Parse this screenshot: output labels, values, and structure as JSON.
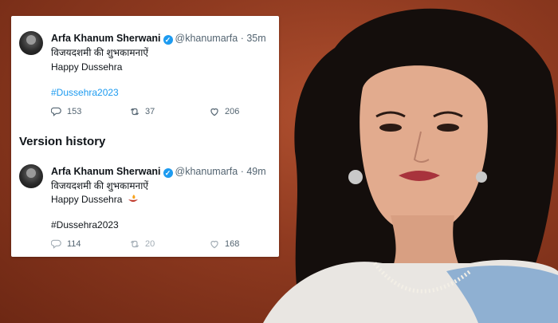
{
  "colors": {
    "accent": "#1d9bf0",
    "background": "#8f3a20"
  },
  "tweets": [
    {
      "name": "Arfa Khanum Sherwani",
      "handle": "@khanumarfa",
      "time": "· 35m",
      "line1": "विजयदशमी की शुभकामनाऐं",
      "line2": "Happy Dussehra",
      "hashtag": "#Dussehra2023",
      "replies": "153",
      "retweets": "37",
      "likes": "206"
    },
    {
      "name": "Arfa Khanum Sherwani",
      "handle": "@khanumarfa",
      "time": "· 49m",
      "line1": "विजयदशमी की शुभकामनाऐं",
      "line2": "Happy Dussehra",
      "hashtag": "#Dussehra2023",
      "replies": "114",
      "retweets": "20",
      "likes": "168",
      "emoji": "diya-lamp-icon"
    }
  ],
  "version_history_label": "Version history"
}
